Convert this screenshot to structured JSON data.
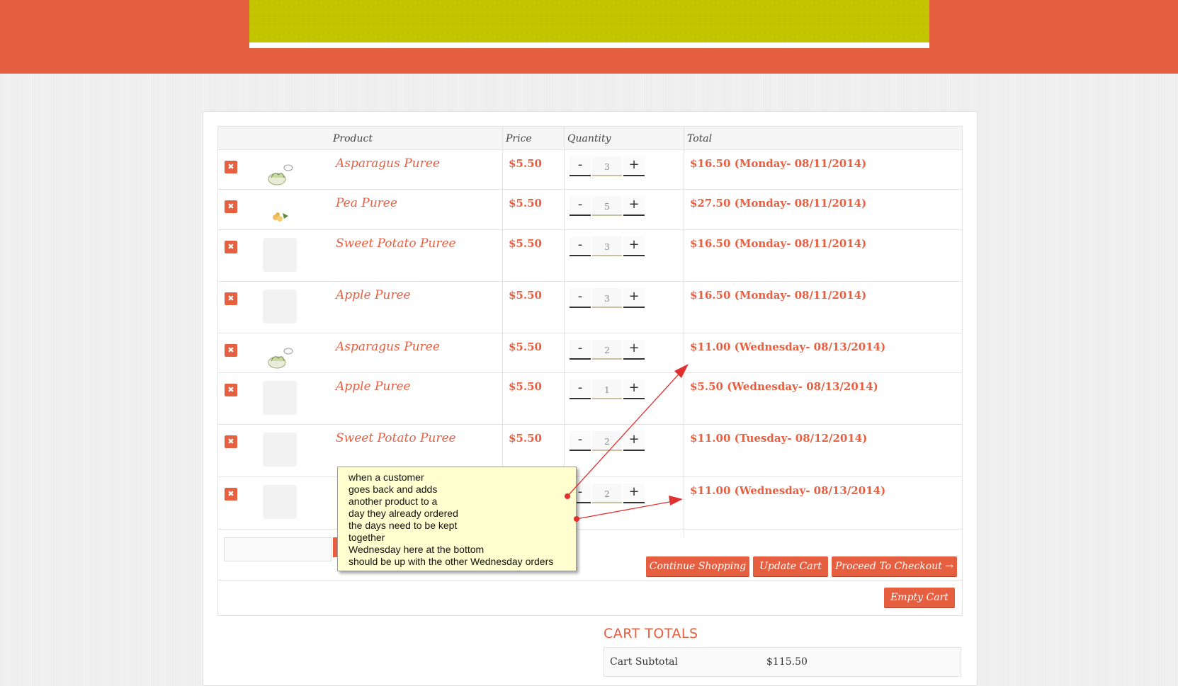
{
  "cart": {
    "headers": {
      "product": "Product",
      "price": "Price",
      "quantity": "Quantity",
      "total": "Total"
    },
    "rows": [
      {
        "name": "Asparagus Puree",
        "price": "$5.50",
        "qty": "3",
        "total": "$16.50 (Monday- 08/11/2014)",
        "thumb": "asparagus"
      },
      {
        "name": "Pea Puree",
        "price": "$5.50",
        "qty": "5",
        "total": "$27.50 (Monday- 08/11/2014)",
        "thumb": "pea"
      },
      {
        "name": "Sweet Potato Puree",
        "price": "$5.50",
        "qty": "3",
        "total": "$16.50 (Monday- 08/11/2014)",
        "thumb": "placeholder"
      },
      {
        "name": "Apple Puree",
        "price": "$5.50",
        "qty": "3",
        "total": "$16.50 (Monday- 08/11/2014)",
        "thumb": "placeholder"
      },
      {
        "name": "Asparagus Puree",
        "price": "$5.50",
        "qty": "2",
        "total": "$11.00 (Wednesday- 08/13/2014)",
        "thumb": "asparagus"
      },
      {
        "name": "Apple Puree",
        "price": "$5.50",
        "qty": "1",
        "total": "$5.50 (Wednesday- 08/13/2014)",
        "thumb": "placeholder"
      },
      {
        "name": "Sweet Potato Puree",
        "price": "$5.50",
        "qty": "2",
        "total": "$11.00 (Tuesday- 08/12/2014)",
        "thumb": "placeholder"
      },
      {
        "name": "",
        "price": "",
        "qty": "2",
        "total": "$11.00 (Wednesday- 08/13/2014)",
        "thumb": "placeholder"
      }
    ],
    "remove_icon": "x-icon",
    "minus_label": "-",
    "plus_label": "+"
  },
  "actions": {
    "continue": "Continue Shopping",
    "update": "Update Cart",
    "checkout": "Proceed To Checkout →",
    "empty": "Empty Cart"
  },
  "totals": {
    "title": "CART TOTALS",
    "subtotal_label": "Cart Subtotal",
    "subtotal_value": "$115.50"
  },
  "note": {
    "lines": [
      "when a customer",
      "goes back and adds",
      "another product to a",
      "day they already ordered",
      "the days need to be kept",
      "together",
      "Wednesday here at the bottom",
      "should be up with the other Wednesday orders"
    ]
  },
  "colors": {
    "accent": "#e75f41",
    "banner": "#c3c400",
    "note_bg": "#ffffd0"
  }
}
